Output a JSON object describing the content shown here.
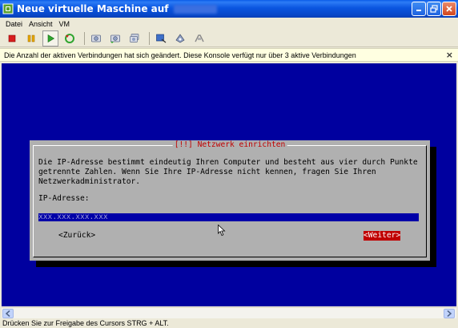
{
  "window": {
    "title": "Neue virtuelle Maschine auf",
    "controls": {
      "minimize": "minimize-icon",
      "maximize": "maximize-icon",
      "close": "close-icon"
    }
  },
  "menu": {
    "items": [
      "Datei",
      "Ansicht",
      "VM"
    ]
  },
  "toolbar": {
    "buttons": [
      "power-off-icon",
      "suspend-icon",
      "power-on-icon",
      "reset-icon",
      "snapshot-icon",
      "revert-snapshot-icon",
      "manage-snapshots-icon",
      "console-fullscreen-icon",
      "vm-settings-icon",
      "send-ctrl-alt-del-icon"
    ]
  },
  "notification": {
    "text": "Die Anzahl der aktiven Verbindungen hat sich geändert. Diese Konsole verfügt nur über 3 aktive Verbindungen",
    "close": "×"
  },
  "dialog": {
    "title": "[!!] Netzwerk einrichten",
    "body": "Die IP-Adresse bestimmt eindeutig Ihren Computer und besteht aus vier durch Punkte\ngetrennte Zahlen. Wenn Sie Ihre IP-Adresse nicht kennen, fragen Sie Ihren\nNetzwerkadministrator.",
    "field_label": "IP-Adresse:",
    "field_value": "xxx.xxx.xxx.xxx",
    "back_button": "<Zurück>",
    "next_button": "<Weiter>"
  },
  "status": {
    "text": "Drücken Sie zur Freigabe des Cursors STRG + ALT."
  },
  "colors": {
    "console_bg": "#00009f",
    "dialog_bg": "#b0b0b0",
    "accent_red": "#c00000",
    "titlebar_blue": "#0a55e0"
  }
}
